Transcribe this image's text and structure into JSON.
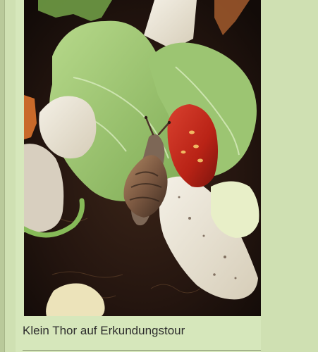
{
  "post": {
    "caption": "Klein Thor auf Erkundungstour"
  },
  "image": {
    "subject": "snail-on-lettuce-photo"
  },
  "colors": {
    "page_background": "#cfe0b2",
    "card_background": "#d6e7bb",
    "caption_text": "#2d2d2d"
  }
}
